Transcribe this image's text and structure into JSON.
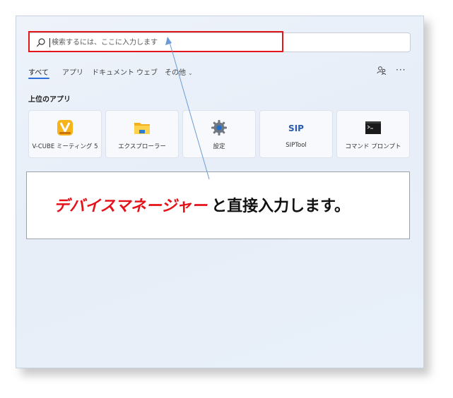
{
  "search": {
    "placeholder": "検索するには、ここに入力します"
  },
  "tabs": [
    {
      "label": "すべて"
    },
    {
      "label": "アプリ"
    },
    {
      "label": "ドキュメント"
    },
    {
      "label": "ウェブ"
    },
    {
      "label": "その他"
    }
  ],
  "toolbar": {
    "more_label": "···"
  },
  "top_apps": {
    "title": "上位のアプリ",
    "items": [
      {
        "label": "V-CUBE ミーティング 5",
        "icon": "v-cube-icon"
      },
      {
        "label": "エクスプローラー",
        "icon": "folder-icon"
      },
      {
        "label": "設定",
        "icon": "gear-icon"
      },
      {
        "label": "SIPTool",
        "icon": "sip-icon"
      },
      {
        "label": "コマンド プロンプト",
        "icon": "terminal-icon"
      }
    ]
  },
  "callout": {
    "highlight": "デバイスマネージャー",
    "text": "と直接入力します。"
  },
  "colors": {
    "highlight_border": "#e3161b",
    "callout_red": "#e5121a",
    "arrow": "#6b9bd2",
    "accent": "#2f6fd8"
  }
}
